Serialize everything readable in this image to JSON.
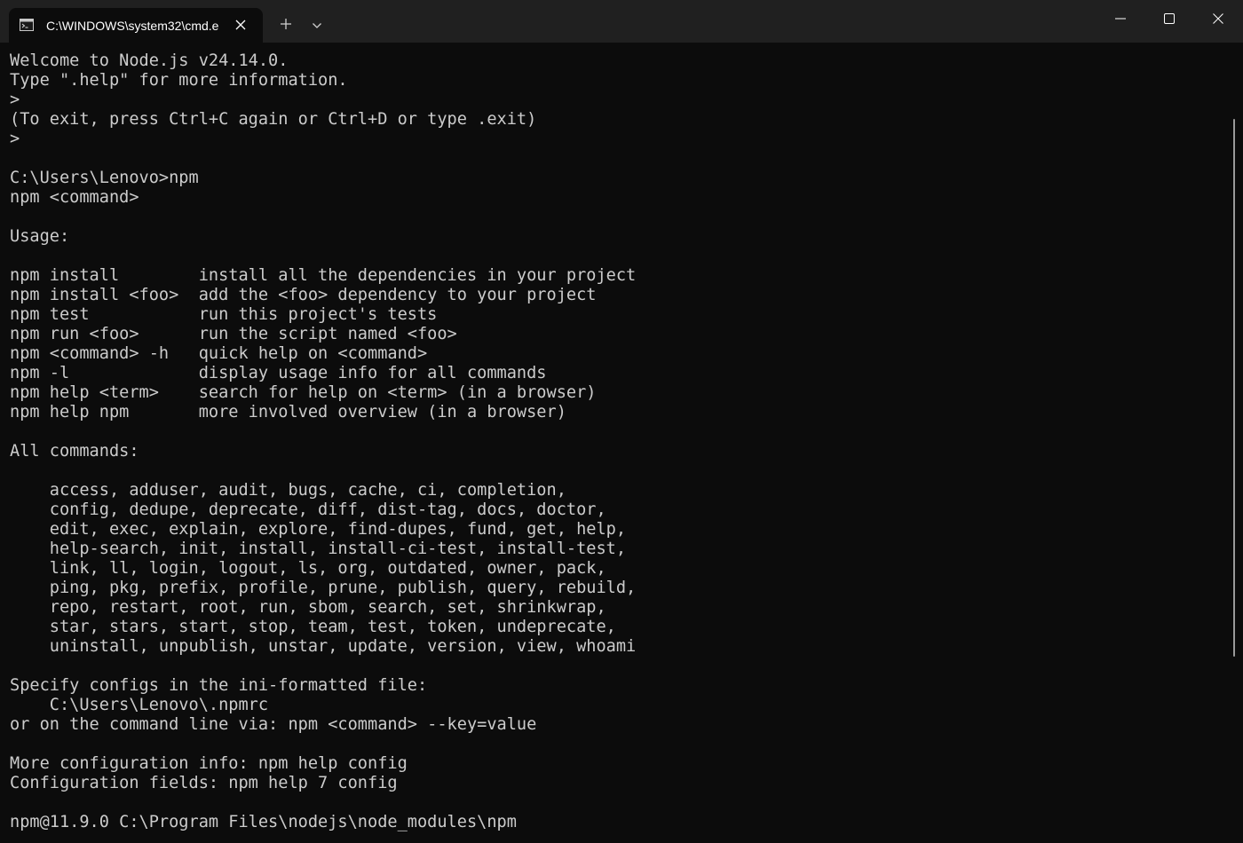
{
  "tab": {
    "title": "C:\\WINDOWS\\system32\\cmd.e",
    "icon": "cmd-icon"
  },
  "titlebar": {
    "new_tab_icon": "plus-icon",
    "dropdown_icon": "chevron-down-icon",
    "minimize_icon": "minimize-icon",
    "maximize_icon": "maximize-icon",
    "close_icon": "close-icon"
  },
  "colors": {
    "background": "#0c0c0c",
    "titlebar": "#202020",
    "text": "#cccccc"
  },
  "console": {
    "lines": [
      "Welcome to Node.js v24.14.0.",
      "Type \".help\" for more information.",
      ">",
      "(To exit, press Ctrl+C again or Ctrl+D or type .exit)",
      ">",
      "",
      "C:\\Users\\Lenovo>npm",
      "npm <command>",
      "",
      "Usage:",
      "",
      "npm install        install all the dependencies in your project",
      "npm install <foo>  add the <foo> dependency to your project",
      "npm test           run this project's tests",
      "npm run <foo>      run the script named <foo>",
      "npm <command> -h   quick help on <command>",
      "npm -l             display usage info for all commands",
      "npm help <term>    search for help on <term> (in a browser)",
      "npm help npm       more involved overview (in a browser)",
      "",
      "All commands:",
      "",
      "    access, adduser, audit, bugs, cache, ci, completion,",
      "    config, dedupe, deprecate, diff, dist-tag, docs, doctor,",
      "    edit, exec, explain, explore, find-dupes, fund, get, help,",
      "    help-search, init, install, install-ci-test, install-test,",
      "    link, ll, login, logout, ls, org, outdated, owner, pack,",
      "    ping, pkg, prefix, profile, prune, publish, query, rebuild,",
      "    repo, restart, root, run, sbom, search, set, shrinkwrap,",
      "    star, stars, start, stop, team, test, token, undeprecate,",
      "    uninstall, unpublish, unstar, update, version, view, whoami",
      "",
      "Specify configs in the ini-formatted file:",
      "    C:\\Users\\Lenovo\\.npmrc",
      "or on the command line via: npm <command> --key=value",
      "",
      "More configuration info: npm help config",
      "Configuration fields: npm help 7 config",
      "",
      "npm@11.9.0 C:\\Program Files\\nodejs\\node_modules\\npm"
    ]
  }
}
